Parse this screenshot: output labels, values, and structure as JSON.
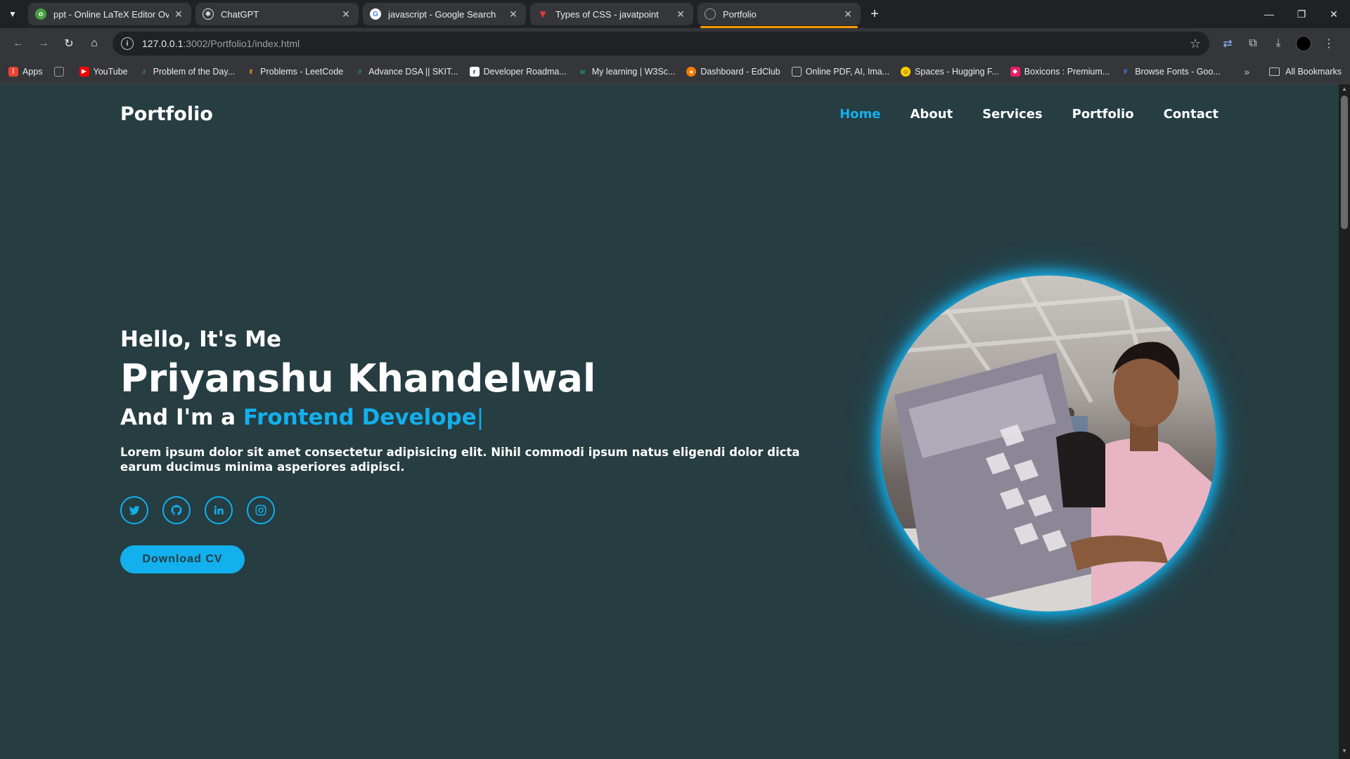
{
  "browser": {
    "tabs": [
      {
        "title": "ppt - Online LaTeX Editor Overleaf",
        "favicon": "overleaf-icon",
        "color": "#47a141"
      },
      {
        "title": "ChatGPT",
        "favicon": "chatgpt-icon",
        "color": "#e8eaed"
      },
      {
        "title": "javascript - Google Search",
        "favicon": "google-icon",
        "color": "#4285f4"
      },
      {
        "title": "Types of CSS - javatpoint",
        "favicon": "javatpoint-icon",
        "color": "#e53935"
      },
      {
        "title": "Portfolio",
        "favicon": "globe-icon",
        "color": "#9aa0a6",
        "active": true
      }
    ],
    "address": {
      "host": "127.0.0.1",
      "path": ":3002/Portfolio1/index.html"
    },
    "bookmarks": [
      {
        "label": "Apps",
        "color": "#ea4335"
      },
      {
        "label": "",
        "color": "#9aa0a6"
      },
      {
        "label": "YouTube",
        "color": "#ff0000"
      },
      {
        "label": "Problem of the Day...",
        "color": "#2f8d46"
      },
      {
        "label": "Problems - LeetCode",
        "color": "#ffa116"
      },
      {
        "label": "Advance DSA || SKIT...",
        "color": "#2f8d46"
      },
      {
        "label": "Developer Roadma...",
        "color": "#111111"
      },
      {
        "label": "My learning | W3Sc...",
        "color": "#04aa6d"
      },
      {
        "label": "Dashboard - EdClub",
        "color": "#f57c00"
      },
      {
        "label": "Online PDF, AI, Ima...",
        "color": "#5f6368"
      },
      {
        "label": "Spaces - Hugging F...",
        "color": "#ffcc00"
      },
      {
        "label": "Boxicons : Premium...",
        "color": "#e91e63"
      },
      {
        "label": "Browse Fonts - Goo...",
        "color": "#4285f4"
      }
    ],
    "all_bookmarks": "All Bookmarks"
  },
  "site": {
    "logo": "Portfolio",
    "nav": [
      {
        "label": "Home",
        "active": true
      },
      {
        "label": "About"
      },
      {
        "label": "Services"
      },
      {
        "label": "Portfolio"
      },
      {
        "label": "Contact"
      }
    ],
    "hero": {
      "hello": "Hello, It's Me",
      "name": "Priyanshu Khandelwal",
      "role_prefix": "And I'm a ",
      "role_typed": "Frontend Develope",
      "caret": "|",
      "description": "Lorem ipsum dolor sit amet consectetur adipisicing elit. Nihil commodi ipsum natus eligendi dolor dicta earum ducimus minima asperiores adipisci.",
      "socials": [
        "twitter-icon",
        "github-icon",
        "linkedin-icon",
        "instagram-icon"
      ],
      "cta": "Download CV"
    },
    "accent": "#12b0ec",
    "background": "#263d42"
  }
}
